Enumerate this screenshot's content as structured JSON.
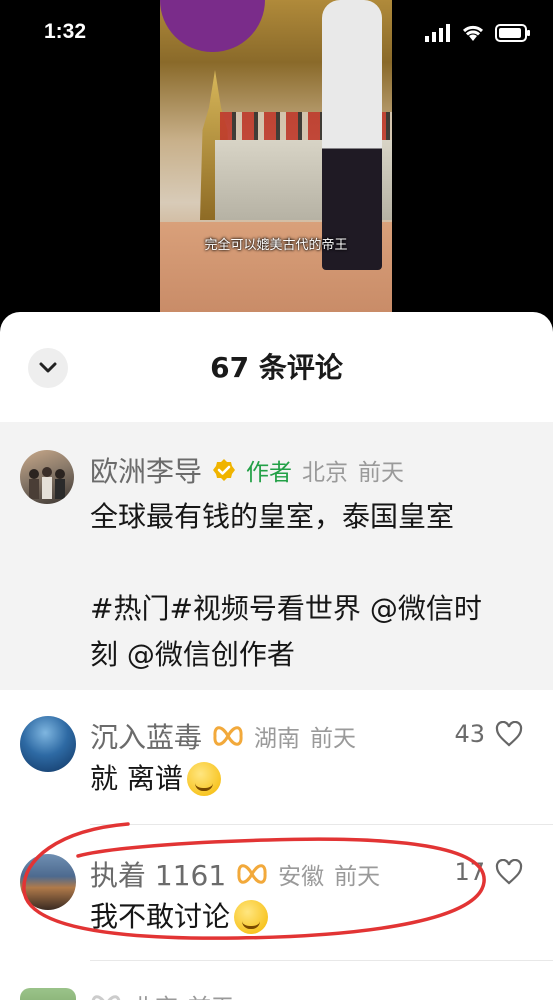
{
  "status_bar": {
    "time": "1:32"
  },
  "video": {
    "caption": "完全可以媲美古代的帝王"
  },
  "sheet": {
    "title": "67 条评论"
  },
  "author_comment": {
    "username": "欧洲李导",
    "badge": "作者",
    "location": "北京",
    "time": "前天",
    "text_line1": "全球最有钱的皇室，泰国皇室",
    "text_line2": "#热门#视频号看世界 @微信时",
    "text_line3": "刻 @微信创作者",
    "verified_color": "#f0b400",
    "badge_color": "#22a046"
  },
  "comments": [
    {
      "username": "沉入蓝毒",
      "location": "湖南",
      "time": "前天",
      "likes": "43",
      "text": "就 离谱",
      "badge_icon": "ribbon-icon"
    },
    {
      "username": "执着 1161",
      "location": "安徽",
      "time": "前天",
      "likes": "17",
      "text": "我不敢讨论",
      "badge_icon": "ribbon-icon"
    },
    {
      "location": "北京",
      "time": "前天"
    }
  ],
  "colors": {
    "annotation": "#e23434",
    "ribbon": "#f2a93b"
  }
}
